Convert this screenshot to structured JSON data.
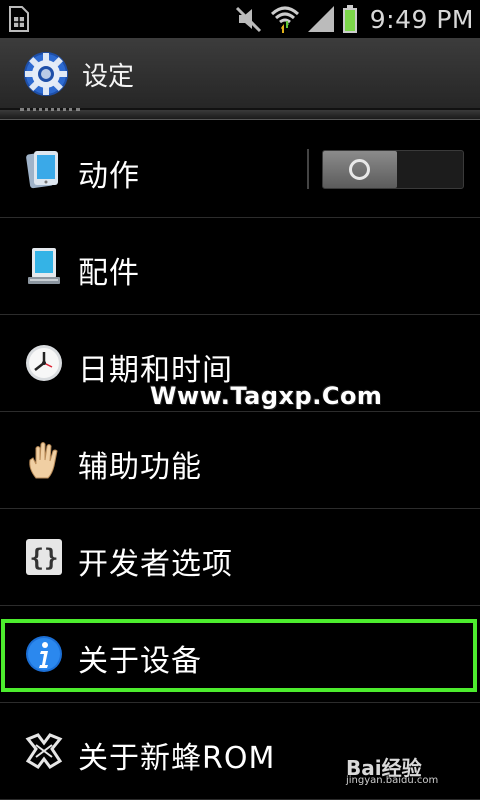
{
  "status_bar": {
    "time": "9:49 PM",
    "icons": [
      "sim-card-icon",
      "mute-icon",
      "wifi-icon",
      "signal-icon",
      "battery-icon"
    ]
  },
  "action_bar": {
    "title": "设定",
    "icon": "settings-gear-icon"
  },
  "list": {
    "items": [
      {
        "label": "动作",
        "icon": "motion-phone-icon",
        "toggle": {
          "state": "off"
        }
      },
      {
        "label": "配件",
        "icon": "accessory-dock-icon"
      },
      {
        "label": "日期和时间",
        "icon": "clock-icon"
      },
      {
        "label": "辅助功能",
        "icon": "hand-icon"
      },
      {
        "label": "开发者选项",
        "icon": "braces-icon"
      },
      {
        "label": "关于设备",
        "icon": "info-icon",
        "highlighted": true
      },
      {
        "label": "关于新蜂ROM",
        "icon": "bee-logo-icon"
      }
    ]
  },
  "overlays": {
    "watermark": "Www.Tagxp.Com",
    "baidu_logo": "Bai经验",
    "baidu_url": "jingyan.baidu.com"
  },
  "colors": {
    "highlight": "#4ded2e",
    "background": "#000000",
    "action_bar": "#333333"
  }
}
